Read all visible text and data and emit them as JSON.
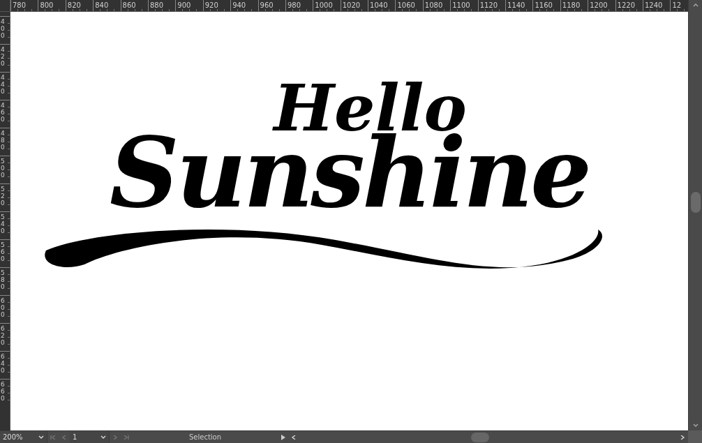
{
  "rulers": {
    "horizontal": [
      "780",
      "800",
      "820",
      "840",
      "860",
      "880",
      "900",
      "920",
      "940",
      "960",
      "980",
      "1000",
      "1020",
      "1040",
      "1060",
      "1080",
      "1100",
      "1120",
      "1140",
      "1160",
      "1180",
      "1200",
      "1220",
      "1240",
      "12"
    ],
    "vertical": [
      "400",
      "420",
      "440",
      "460",
      "480",
      "500",
      "520",
      "540",
      "560",
      "580",
      "600",
      "620",
      "640",
      "660"
    ]
  },
  "artwork": {
    "line_1": "Hello",
    "line_2": "Sunshine"
  },
  "status_bar": {
    "zoom": "200%",
    "artboard": "1",
    "tool": "Selection"
  }
}
